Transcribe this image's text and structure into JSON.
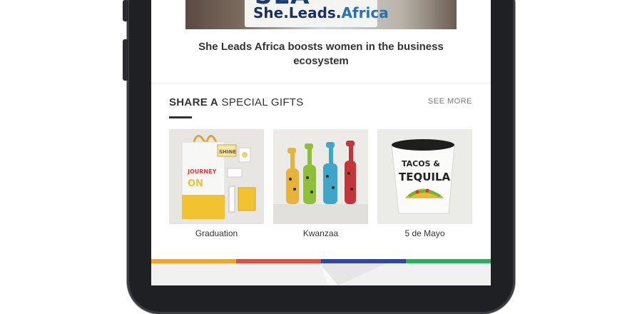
{
  "hero": {
    "sign_big": "SLA",
    "brand_main": "She.Leads.",
    "brand_accent": "Africa"
  },
  "article": {
    "headline": "She Leads Africa boosts women in the business ecosystem"
  },
  "gifts_section": {
    "title_bold": "SHARE A",
    "title_rest": " SPECIAL GIFTS",
    "see_more": "SEE MORE",
    "items": [
      {
        "label": "Graduation"
      },
      {
        "label": "Kwanzaa"
      },
      {
        "label": "5 de Mayo"
      }
    ]
  },
  "graduation_art": {
    "bag_text_1": "JOURNEY",
    "bag_text_2": "ON",
    "sign": "SHINE"
  },
  "mayo_art": {
    "cup_text_1": "TACOS &",
    "cup_text_2": "TEQUILA"
  },
  "colors": {
    "bar": [
      "#f5a623",
      "#e74c3c",
      "#2e4a9e",
      "#27ae60"
    ]
  }
}
